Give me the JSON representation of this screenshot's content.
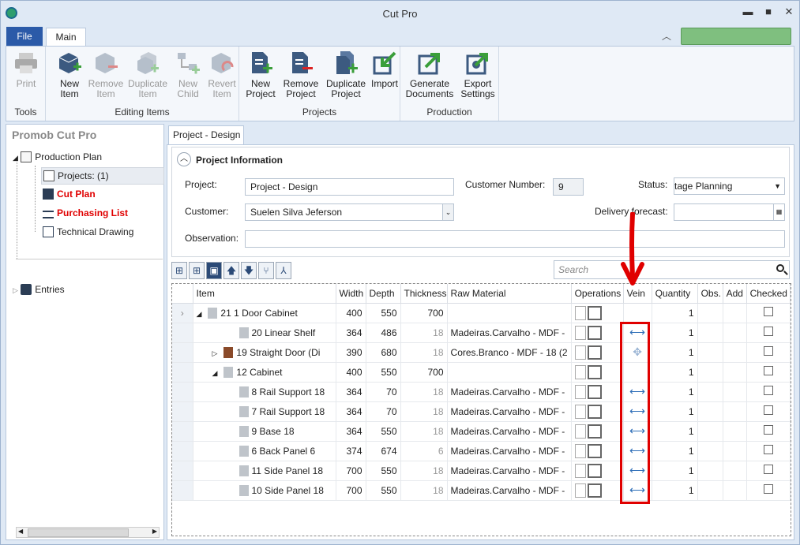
{
  "window": {
    "title": "Cut Pro",
    "minimize": "▬",
    "maximize": "■",
    "close": "✕"
  },
  "tabs": {
    "file": "File",
    "main": "Main"
  },
  "ribbon": {
    "groups": [
      {
        "label": "Tools",
        "buttons": [
          {
            "label": "Print",
            "disabled": true
          }
        ]
      },
      {
        "label": "Editing Items",
        "buttons": [
          {
            "label": "New\nItem"
          },
          {
            "label": "Remove\nItem"
          },
          {
            "label": "Duplicate\nItem"
          },
          {
            "label": "New\nChild"
          },
          {
            "label": "Revert\nItem"
          }
        ]
      },
      {
        "label": "Projects",
        "buttons": [
          {
            "label": "New\nProject"
          },
          {
            "label": "Remove\nProject"
          },
          {
            "label": "Duplicate\nProject"
          },
          {
            "label": "Import"
          }
        ]
      },
      {
        "label": "Production",
        "buttons": [
          {
            "label": "Generate\nDocuments"
          },
          {
            "label": "Export\nSettings"
          }
        ]
      }
    ]
  },
  "sidebar": {
    "title": "Promob Cut Pro",
    "items": [
      {
        "label": "Production Plan"
      },
      {
        "label": "Projects: (1)"
      },
      {
        "label": "Cut Plan"
      },
      {
        "label": "Purchasing List"
      },
      {
        "label": "Technical Drawing"
      },
      {
        "label": "Entries"
      }
    ]
  },
  "doc_tab": "Project - Design",
  "project_info": {
    "title": "Project Information",
    "project_label": "Project:",
    "project_value": "Project - Design",
    "customer_number_label": "Customer Number:",
    "customer_number_value": "9",
    "status_label": "Status:",
    "status_value": "tage Planning",
    "customer_label": "Customer:",
    "customer_value": "Suelen Silva Jeferson",
    "delivery_label": "Delivery forecast:",
    "observation_label": "Observation:"
  },
  "search": {
    "placeholder": "Search"
  },
  "grid": {
    "columns": [
      "Item",
      "Width",
      "Depth",
      "Thickness",
      "Raw Material",
      "Operations",
      "Vein",
      "Quantity",
      "Obs.",
      "Add",
      "Checked"
    ],
    "rows": [
      {
        "item": "21  1 Door Cabinet",
        "width": "400",
        "depth": "550",
        "thickness": "700",
        "material": "",
        "vein": "",
        "qty": "1",
        "level": 0,
        "expander": "◢",
        "current": true
      },
      {
        "item": "20 Linear Shelf",
        "width": "364",
        "depth": "486",
        "thickness": "18",
        "material": "Madeiras.Carvalho - MDF -",
        "vein": "⟷",
        "qty": "1",
        "level": 2
      },
      {
        "item": "19 Straight Door (Di",
        "width": "390",
        "depth": "680",
        "thickness": "18",
        "material": "Cores.Branco - MDF - 18 (2",
        "vein": "✥",
        "qty": "1",
        "level": 1,
        "expander": "▷"
      },
      {
        "item": "12 Cabinet",
        "width": "400",
        "depth": "550",
        "thickness": "700",
        "material": "",
        "vein": "",
        "qty": "1",
        "level": 1,
        "expander": "◢"
      },
      {
        "item": "8 Rail Support 18",
        "width": "364",
        "depth": "70",
        "thickness": "18",
        "material": "Madeiras.Carvalho - MDF -",
        "vein": "⟷",
        "qty": "1",
        "level": 2
      },
      {
        "item": "7 Rail Support 18",
        "width": "364",
        "depth": "70",
        "thickness": "18",
        "material": "Madeiras.Carvalho - MDF -",
        "vein": "⟷",
        "qty": "1",
        "level": 2
      },
      {
        "item": "9 Base 18",
        "width": "364",
        "depth": "550",
        "thickness": "18",
        "material": "Madeiras.Carvalho - MDF -",
        "vein": "⟷",
        "qty": "1",
        "level": 2
      },
      {
        "item": "6 Back Panel 6",
        "width": "374",
        "depth": "674",
        "thickness": "6",
        "material": "Madeiras.Carvalho - MDF -",
        "vein": "⟷",
        "qty": "1",
        "level": 2
      },
      {
        "item": "11 Side Panel 18",
        "width": "700",
        "depth": "550",
        "thickness": "18",
        "material": "Madeiras.Carvalho - MDF -",
        "vein": "⟷",
        "qty": "1",
        "level": 2
      },
      {
        "item": "10 Side Panel 18",
        "width": "700",
        "depth": "550",
        "thickness": "18",
        "material": "Madeiras.Carvalho - MDF -",
        "vein": "⟷",
        "qty": "1",
        "level": 2
      }
    ]
  },
  "colors": {
    "accent": "#2b5aa8",
    "highlight": "#e00000"
  }
}
